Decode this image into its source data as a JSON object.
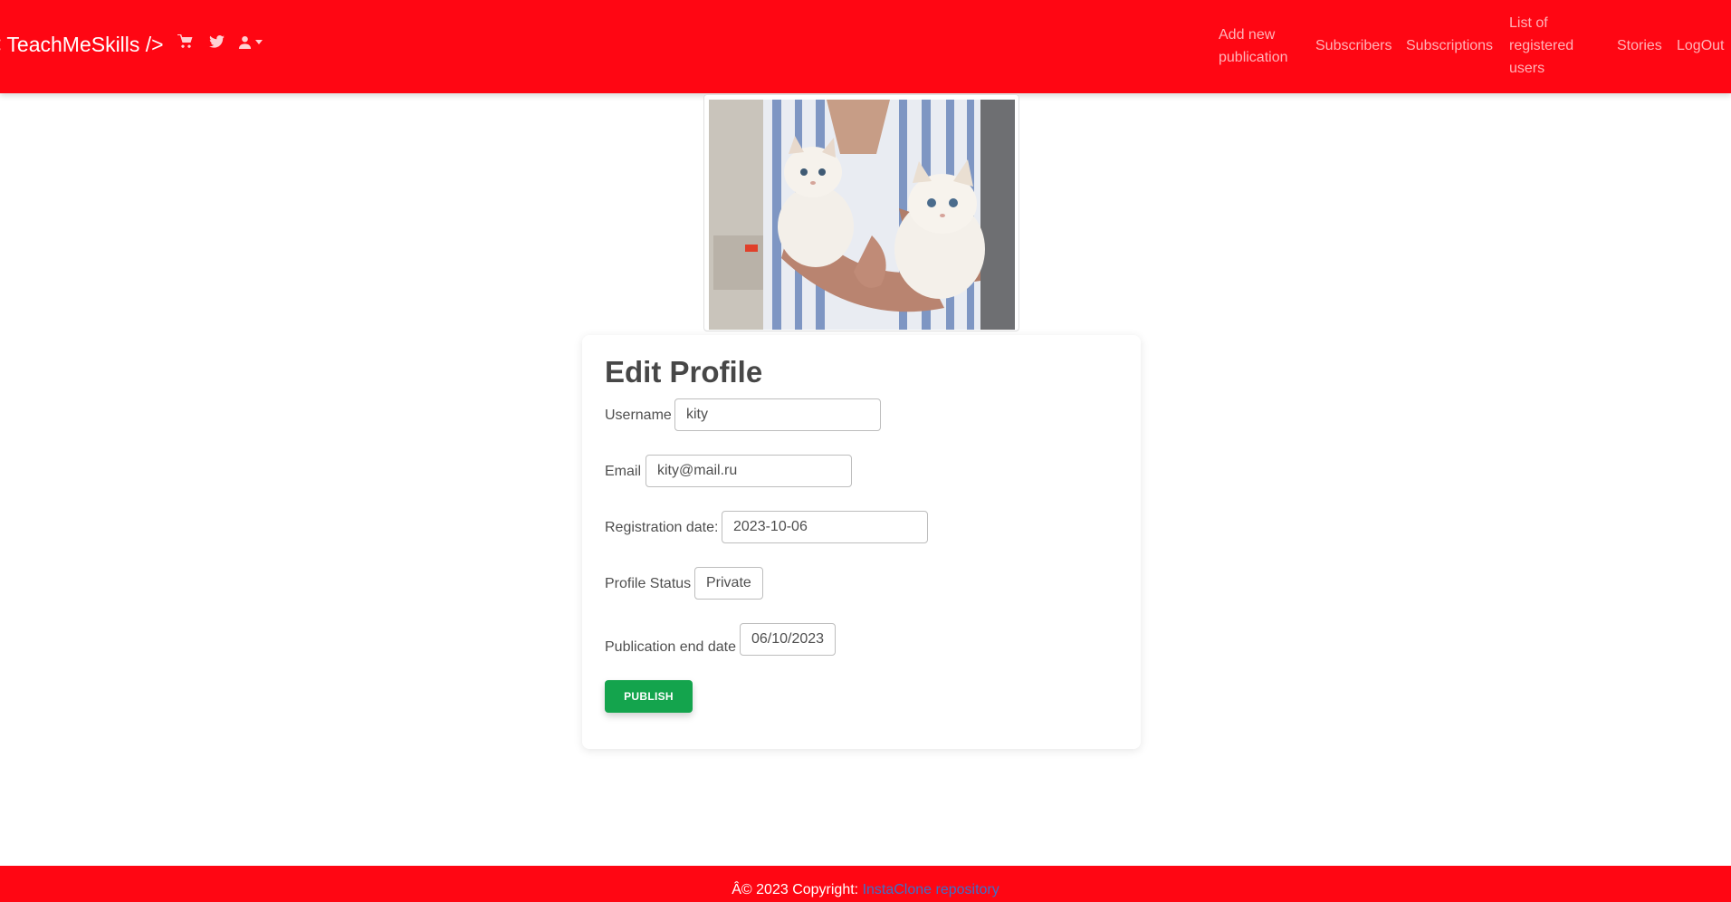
{
  "navbar": {
    "brand": "< TeachMeSkills />",
    "icons": [
      "cart-icon",
      "twitter-icon",
      "user-icon",
      "caret-down-icon"
    ],
    "links": {
      "add_new": "Add new\npublication",
      "subscribers": "Subscribers",
      "subscriptions": "Subscriptions",
      "registered": "List of\nregistered\nusers",
      "stories": "Stories",
      "logout": "LogOut"
    },
    "colors": {
      "background": "#ff0613",
      "link": "#ffb3b8"
    }
  },
  "avatar": {
    "alt": "Profile photo with two white kittens"
  },
  "form": {
    "title": "Edit Profile",
    "username_label": "Username",
    "username_value": "kity",
    "email_label": "Email",
    "email_value": "kity@mail.ru",
    "regdate_label": "Registration date:",
    "regdate_value": "2023-10-06",
    "status_label": "Profile Status",
    "status_value": "Private",
    "enddate_label": "Publication end date",
    "enddate_value": "06/10/2023",
    "publish_label": "PUBLISH",
    "colors": {
      "publish": "#14a44d"
    }
  },
  "footer": {
    "copyright": "Â© 2023 Copyright: ",
    "link_text": "InstaClone repository"
  }
}
